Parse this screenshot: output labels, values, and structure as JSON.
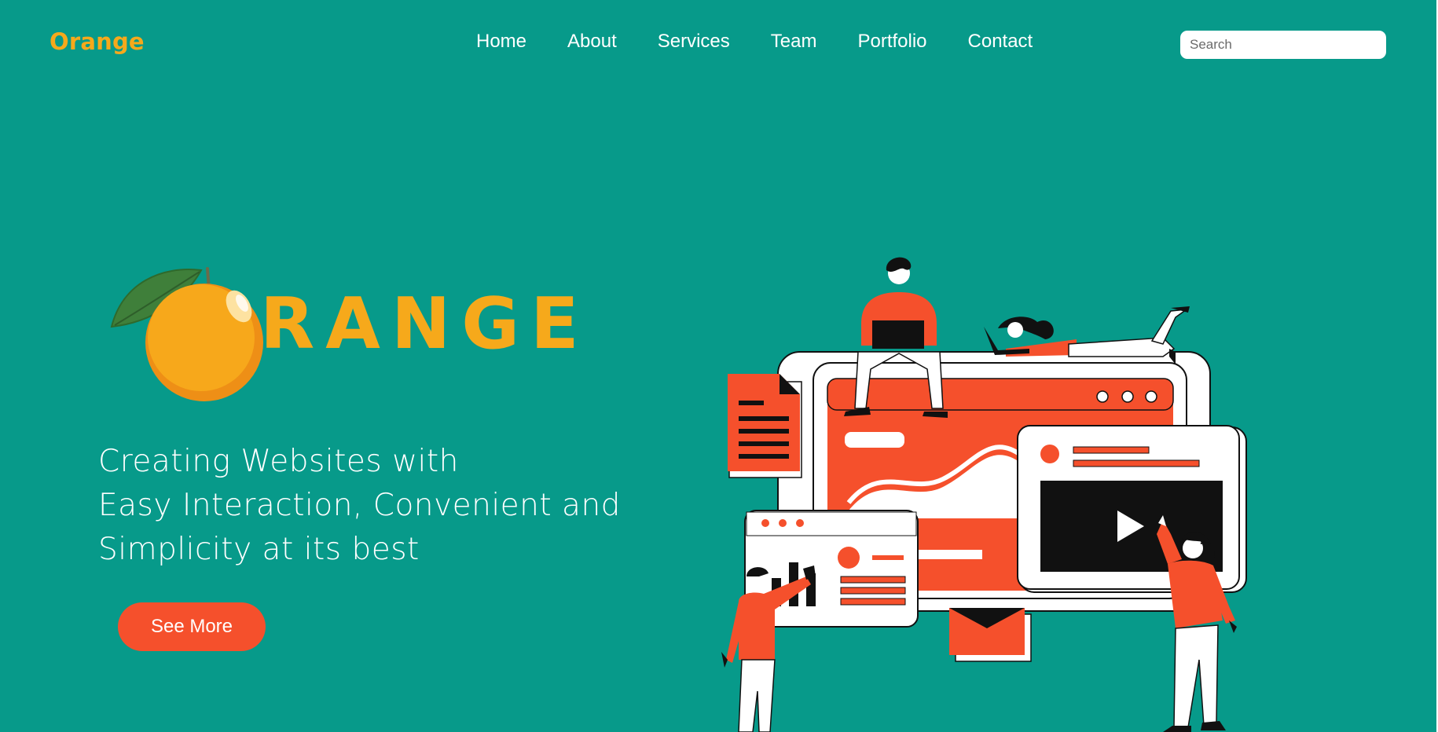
{
  "header": {
    "brand": "Orange",
    "nav": [
      "Home",
      "About",
      "Services",
      "Team",
      "Portfolio",
      "Contact"
    ],
    "search_placeholder": "Search"
  },
  "hero": {
    "logo_word": "RANGE",
    "tagline": [
      "Creating Websites with",
      "Easy Interaction, Convenient and",
      "Simplicity at its best"
    ],
    "cta_label": "See More"
  },
  "colors": {
    "background": "#079a8a",
    "brand_orange": "#f6a91b",
    "accent_red": "#f5502c",
    "ink": "#111111",
    "white": "#ffffff"
  },
  "icons": {
    "logo": "orange-fruit-icon",
    "illustration": "web-development-team-illustration",
    "play": "play-icon",
    "document": "document-icon",
    "envelope": "envelope-icon",
    "bar_chart": "bar-chart-icon"
  }
}
